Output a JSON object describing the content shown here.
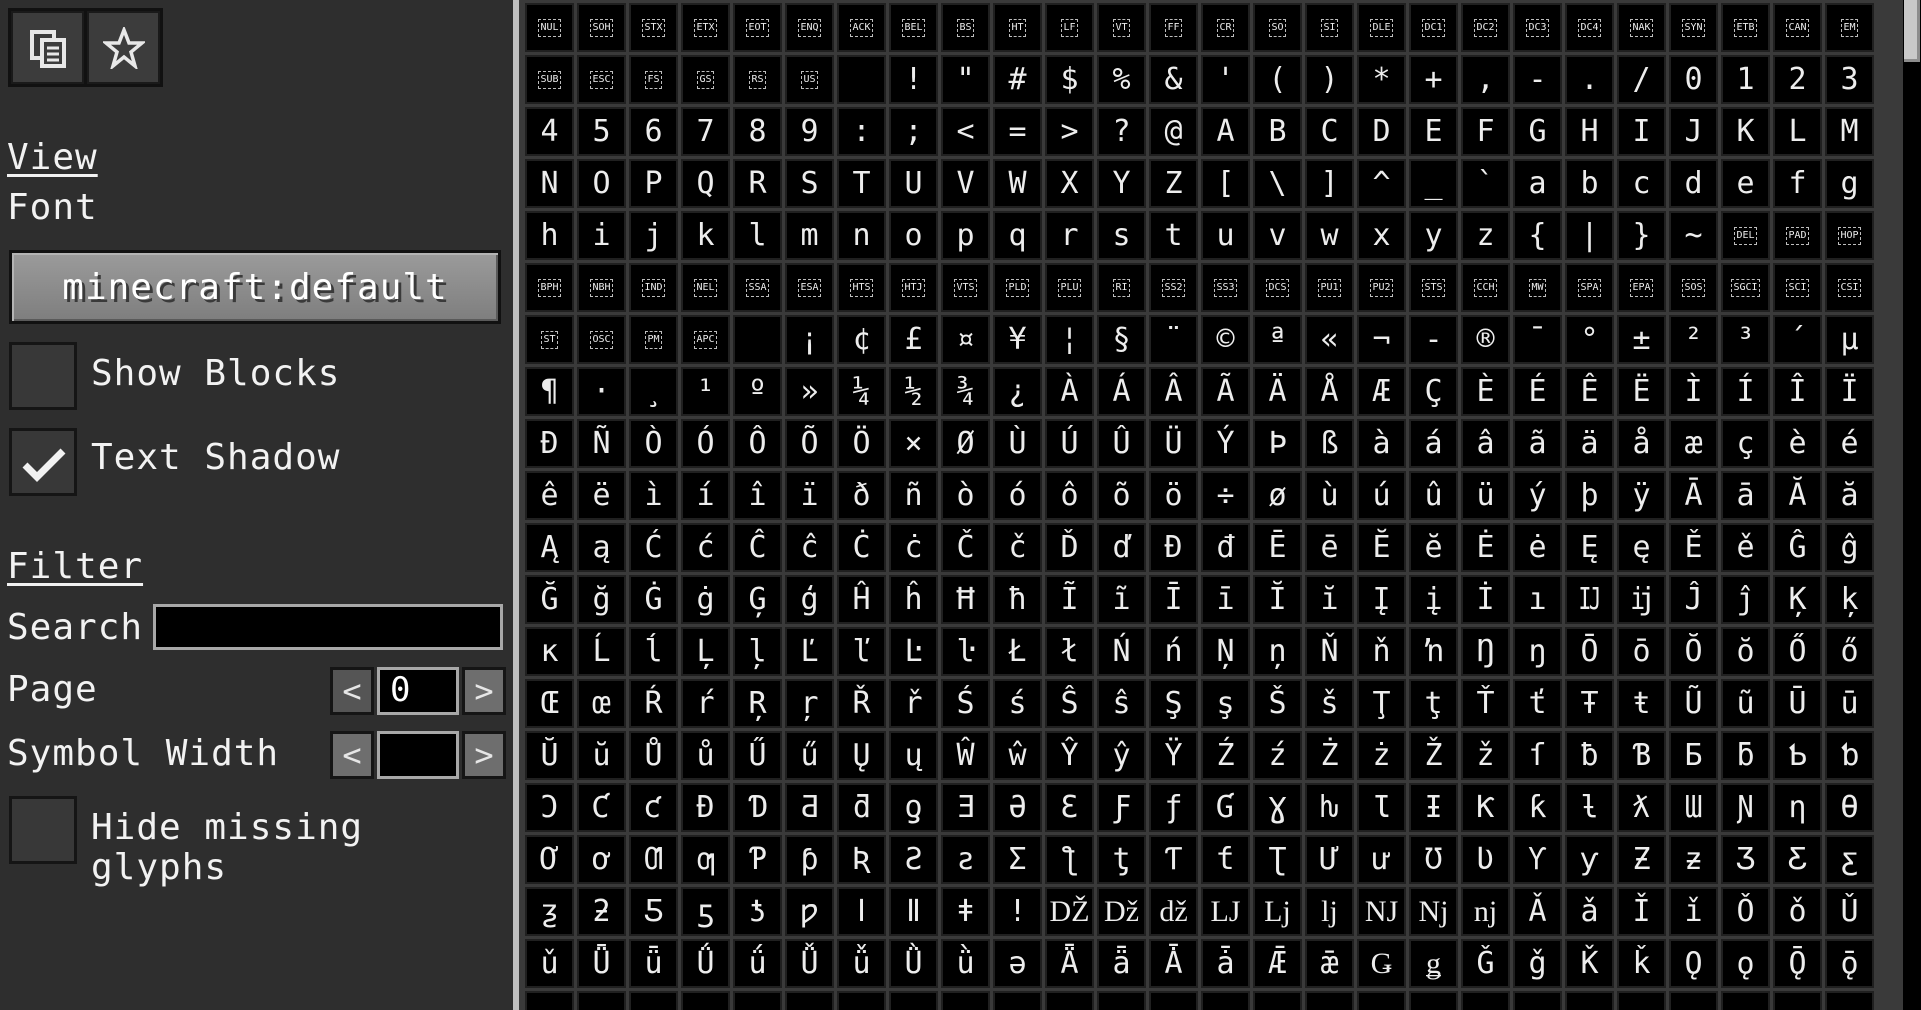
{
  "toolbar": {
    "buttons": [
      {
        "name": "copy-icon"
      },
      {
        "name": "star-icon"
      }
    ]
  },
  "view": {
    "heading": "View",
    "font_label": "Font",
    "font_value": "minecraft:default",
    "show_blocks_label": "Show Blocks",
    "show_blocks_checked": false,
    "text_shadow_label": "Text Shadow",
    "text_shadow_checked": true
  },
  "filter": {
    "heading": "Filter",
    "search_label": "Search",
    "search_value": "",
    "page_label": "Page",
    "page_value": "0",
    "symbol_width_label": "Symbol Width",
    "symbol_width_value": "",
    "prev": "<",
    "next": ">",
    "hide_missing_label": "Hide missing glyphs",
    "hide_missing_checked": false
  },
  "colors": {
    "panel_bg": "#2e2e2e",
    "grid_bg": "#000000",
    "text": "#f2f2f2"
  },
  "glyphs": [
    [
      "NUL",
      "SOH",
      "STX",
      "ETX",
      "EOT",
      "ENQ",
      "ACK",
      "BEL",
      "BS",
      "HT",
      "LF",
      "VT",
      "FF",
      "CR",
      "SO",
      "SI",
      "DLE",
      "DC1",
      "DC2",
      "DC3",
      "DC4",
      "NAK",
      "SYN",
      "ETB",
      "CAN",
      "EM"
    ],
    [
      "SUB",
      "ESC",
      "FS",
      "GS",
      "RS",
      "US",
      " ",
      "!",
      "\"",
      "#",
      "$",
      "%",
      "&",
      "'",
      "(",
      ")",
      "*",
      "+",
      ",",
      "-",
      ".",
      "/",
      "0",
      "1",
      "2",
      "3"
    ],
    [
      "4",
      "5",
      "6",
      "7",
      "8",
      "9",
      ":",
      ";",
      "<",
      "=",
      ">",
      "?",
      "@",
      "A",
      "B",
      "C",
      "D",
      "E",
      "F",
      "G",
      "H",
      "I",
      "J",
      "K",
      "L",
      "M"
    ],
    [
      "N",
      "O",
      "P",
      "Q",
      "R",
      "S",
      "T",
      "U",
      "V",
      "W",
      "X",
      "Y",
      "Z",
      "[",
      "\\",
      "]",
      "^",
      "_",
      "`",
      "a",
      "b",
      "c",
      "d",
      "e",
      "f",
      "g"
    ],
    [
      "h",
      "i",
      "j",
      "k",
      "l",
      "m",
      "n",
      "o",
      "p",
      "q",
      "r",
      "s",
      "t",
      "u",
      "v",
      "w",
      "x",
      "y",
      "z",
      "{",
      "|",
      "}",
      "~",
      "DEL",
      "PAD",
      "HOP"
    ],
    [
      "BPH",
      "NBH",
      "IND",
      "NEL",
      "SSA",
      "ESA",
      "HTS",
      "HTJ",
      "VTS",
      "PLD",
      "PLU",
      "RI",
      "SS2",
      "SS3",
      "DCS",
      "PU1",
      "PU2",
      "STS",
      "CCH",
      "MW",
      "SPA",
      "EPA",
      "SOS",
      "SGCI",
      "SCI",
      "CSI"
    ],
    [
      "ST",
      "OSC",
      "PM",
      "APC",
      " ",
      "¡",
      "¢",
      "£",
      "¤",
      "¥",
      "¦",
      "§",
      "¨",
      "©",
      "ª",
      "«",
      "¬",
      "-",
      "®",
      "¯",
      "°",
      "±",
      "²",
      "³",
      "´",
      "µ"
    ],
    [
      "¶",
      "·",
      "¸",
      "¹",
      "º",
      "»",
      "¼",
      "½",
      "¾",
      "¿",
      "À",
      "Á",
      "Â",
      "Ã",
      "Ä",
      "Å",
      "Æ",
      "Ç",
      "È",
      "É",
      "Ê",
      "Ë",
      "Ì",
      "Í",
      "Î",
      "Ï"
    ],
    [
      "Ð",
      "Ñ",
      "Ò",
      "Ó",
      "Ô",
      "Õ",
      "Ö",
      "×",
      "Ø",
      "Ù",
      "Ú",
      "Û",
      "Ü",
      "Ý",
      "Þ",
      "ß",
      "à",
      "á",
      "â",
      "ã",
      "ä",
      "å",
      "æ",
      "ç",
      "è",
      "é"
    ],
    [
      "ê",
      "ë",
      "ì",
      "í",
      "î",
      "ï",
      "ð",
      "ñ",
      "ò",
      "ó",
      "ô",
      "õ",
      "ö",
      "÷",
      "ø",
      "ù",
      "ú",
      "û",
      "ü",
      "ý",
      "þ",
      "ÿ",
      "Ā",
      "ā",
      "Ă",
      "ă"
    ],
    [
      "Ą",
      "ą",
      "Ć",
      "ć",
      "Ĉ",
      "ĉ",
      "Ċ",
      "ċ",
      "Č",
      "č",
      "Ď",
      "ď",
      "Đ",
      "đ",
      "Ē",
      "ē",
      "Ĕ",
      "ĕ",
      "Ė",
      "ė",
      "Ę",
      "ę",
      "Ě",
      "ě",
      "Ĝ",
      "ĝ"
    ],
    [
      "Ğ",
      "ğ",
      "Ġ",
      "ġ",
      "Ģ",
      "ģ",
      "Ĥ",
      "ĥ",
      "Ħ",
      "ħ",
      "Ĩ",
      "ĩ",
      "Ī",
      "ī",
      "Ĭ",
      "ĭ",
      "Į",
      "į",
      "İ",
      "ı",
      "Ĳ",
      "ĳ",
      "Ĵ",
      "ĵ",
      "Ķ",
      "ķ"
    ],
    [
      "ĸ",
      "Ĺ",
      "ĺ",
      "Ļ",
      "ļ",
      "Ľ",
      "ľ",
      "Ŀ",
      "ŀ",
      "Ł",
      "ł",
      "Ń",
      "ń",
      "Ņ",
      "ņ",
      "Ň",
      "ň",
      "ŉ",
      "Ŋ",
      "ŋ",
      "Ō",
      "ō",
      "Ŏ",
      "ŏ",
      "Ő",
      "ő"
    ],
    [
      "Œ",
      "œ",
      "Ŕ",
      "ŕ",
      "Ŗ",
      "ŗ",
      "Ř",
      "ř",
      "Ś",
      "ś",
      "Ŝ",
      "ŝ",
      "Ş",
      "ş",
      "Š",
      "š",
      "Ţ",
      "ţ",
      "Ť",
      "ť",
      "Ŧ",
      "ŧ",
      "Ũ",
      "ũ",
      "Ū",
      "ū"
    ],
    [
      "Ŭ",
      "ŭ",
      "Ů",
      "ů",
      "Ű",
      "ű",
      "Ų",
      "ų",
      "Ŵ",
      "ŵ",
      "Ŷ",
      "ŷ",
      "Ÿ",
      "Ź",
      "ź",
      "Ż",
      "ż",
      "Ž",
      "ž",
      "ſ",
      "ƀ",
      "Ɓ",
      "Ƃ",
      "ƃ",
      "Ƅ",
      "ƅ"
    ],
    [
      "Ɔ",
      "Ƈ",
      "ƈ",
      "Ɖ",
      "Ɗ",
      "Ƌ",
      "ƌ",
      "ƍ",
      "Ǝ",
      "Ə",
      "Ɛ",
      "Ƒ",
      "ƒ",
      "Ɠ",
      "Ɣ",
      "ƕ",
      "Ɩ",
      "Ɨ",
      "Ƙ",
      "ƙ",
      "ƚ",
      "ƛ",
      "Ɯ",
      "Ɲ",
      "ƞ",
      "Ɵ"
    ],
    [
      "Ơ",
      "ơ",
      "Ƣ",
      "ƣ",
      "Ƥ",
      "ƥ",
      "Ʀ",
      "Ƨ",
      "ƨ",
      "Ʃ",
      "ƪ",
      "ƫ",
      "Ƭ",
      "ƭ",
      "Ʈ",
      "Ư",
      "ư",
      "Ʊ",
      "Ʋ",
      "Ƴ",
      "ƴ",
      "Ƶ",
      "ƶ",
      "Ʒ",
      "Ƹ",
      "ƹ"
    ],
    [
      "ƺ",
      "ƻ",
      "Ƽ",
      "ƽ",
      "ƾ",
      "ƿ",
      "ǀ",
      "ǁ",
      "ǂ",
      "ǃ",
      "Ǆ",
      "ǅ",
      "ǆ",
      "Ǉ",
      "ǈ",
      "ǉ",
      "Ǌ",
      "ǋ",
      "ǌ",
      "Ǎ",
      "ǎ",
      "Ǐ",
      "ǐ",
      "Ǒ",
      "ǒ",
      "Ǔ"
    ],
    [
      "ǔ",
      "Ǖ",
      "ǖ",
      "Ǘ",
      "ǘ",
      "Ǚ",
      "ǚ",
      "Ǜ",
      "ǜ",
      "ǝ",
      "Ǟ",
      "ǟ",
      "Ǡ",
      "ǡ",
      "Ǣ",
      "ǣ",
      "Ǥ",
      "ǥ",
      "Ǧ",
      "ǧ",
      "Ǩ",
      "ǩ",
      "Ǫ",
      "ǫ",
      "Ǭ",
      "ǭ"
    ],
    [
      " ",
      " ",
      " ",
      " ",
      " ",
      " ",
      " ",
      " ",
      " ",
      " ",
      " ",
      " ",
      " ",
      " ",
      " ",
      " ",
      " ",
      " ",
      " ",
      " ",
      " ",
      " ",
      " ",
      " ",
      " ",
      " "
    ]
  ]
}
